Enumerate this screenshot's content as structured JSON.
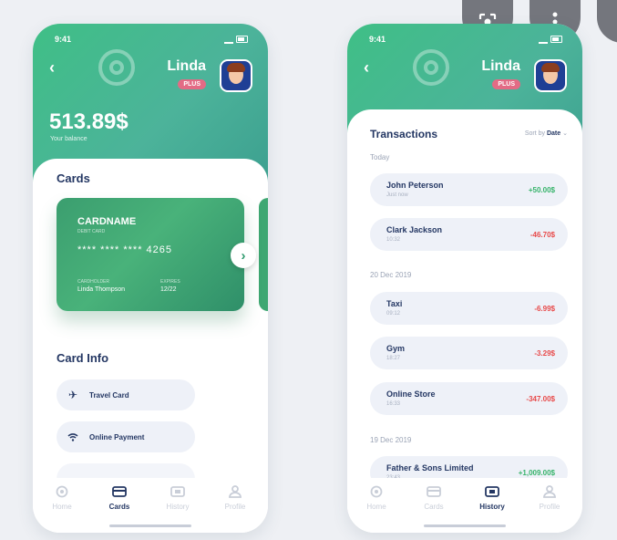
{
  "status": {
    "time": "9:41"
  },
  "user": {
    "name": "Linda",
    "badge": "PLUS"
  },
  "left": {
    "balance": "513.89$",
    "balance_label": "Your balance",
    "cards_title": "Cards",
    "card": {
      "name": "CARDNAME",
      "type": "DEBIT CARD",
      "number": "****  ****  ****  4265",
      "holder_label": "CARDHOLDER",
      "holder": "Linda Thompson",
      "expires_label": "EXPIRES",
      "expires": "12/22"
    },
    "card_info_title": "Card Info",
    "info_items": [
      {
        "label": "Travel Card",
        "icon": "airplane-icon"
      },
      {
        "label": "Online Payment",
        "icon": "wifi-icon"
      }
    ]
  },
  "right": {
    "title": "Transactions",
    "sort_prefix": "Sort by",
    "sort_value": "Date",
    "groups": [
      {
        "date": "Today",
        "items": [
          {
            "name": "John Peterson",
            "sub": "Just now",
            "amount": "+50.00$",
            "positive": true
          },
          {
            "name": "Clark Jackson",
            "sub": "10:32",
            "amount": "-46.70$",
            "positive": false
          }
        ]
      },
      {
        "date": "20 Dec 2019",
        "items": [
          {
            "name": "Taxi",
            "sub": "09:12",
            "amount": "-6.99$",
            "positive": false
          },
          {
            "name": "Gym",
            "sub": "18:27",
            "amount": "-3.29$",
            "positive": false
          },
          {
            "name": "Online Store",
            "sub": "16:33",
            "amount": "-347.00$",
            "positive": false
          }
        ]
      },
      {
        "date": "19 Dec 2019",
        "items": [
          {
            "name": "Father & Sons Limited",
            "sub": "23:43",
            "amount": "+1,009.00$",
            "positive": true
          }
        ]
      }
    ]
  },
  "tabs": [
    "Home",
    "Cards",
    "History",
    "Profile"
  ],
  "colors": {
    "accent": "#3fbf86",
    "navy": "#243763",
    "positive": "#36b36a",
    "negative": "#e84a4a"
  }
}
